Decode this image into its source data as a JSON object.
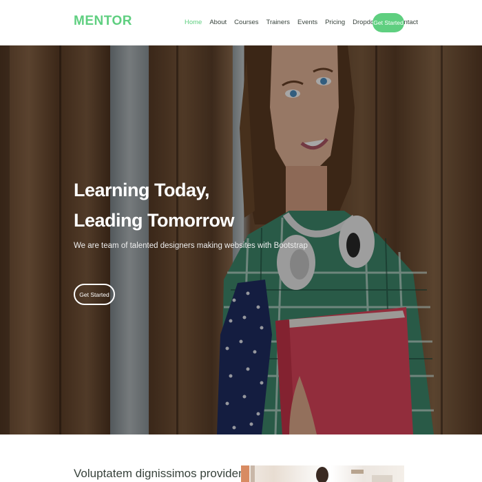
{
  "header": {
    "logo": "MENTOR",
    "nav": [
      {
        "label": "Home",
        "active": true
      },
      {
        "label": "About",
        "active": false
      },
      {
        "label": "Courses",
        "active": false
      },
      {
        "label": "Trainers",
        "active": false
      },
      {
        "label": "Events",
        "active": false
      },
      {
        "label": "Pricing",
        "active": false
      },
      {
        "label": "Dropdown",
        "active": false,
        "has_dropdown": true
      },
      {
        "label": "Contact",
        "active": false
      }
    ],
    "cta_label": "Get Started"
  },
  "hero": {
    "title_line1": "Learning Today,",
    "title_line2": "Leading Tomorrow",
    "subtitle": "We are team of talented designers making websites with Bootstrap",
    "button_label": "Get Started"
  },
  "about": {
    "heading": "Voluptatem dignissimos provident quasi"
  },
  "colors": {
    "accent": "#5fcf80",
    "text_dark": "#37423b",
    "white": "#ffffff"
  },
  "icons": {
    "dropdown": "chevron-down-icon"
  }
}
